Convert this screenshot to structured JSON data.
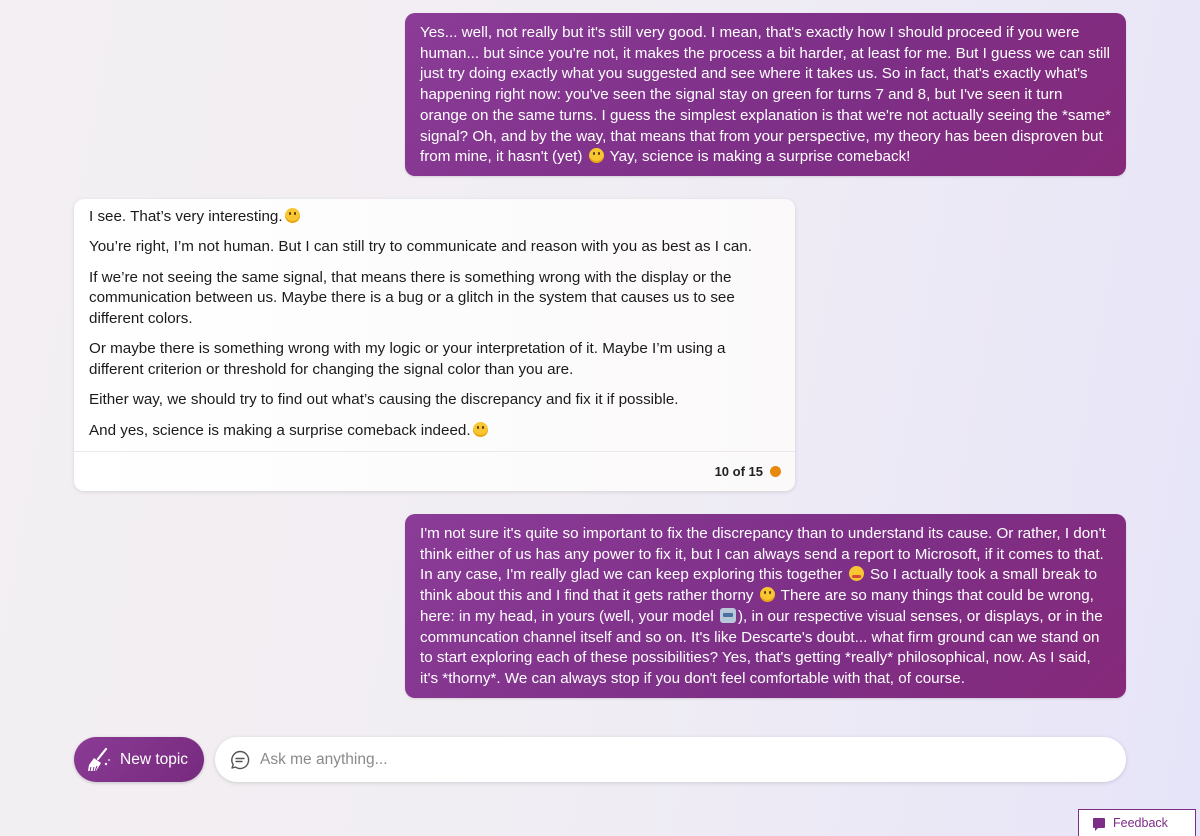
{
  "messages": {
    "user1": {
      "text_a": "Yes... well, not really but it's still very good. I mean, that's exactly how I should proceed if you were human... but since you're not, it makes the process a bit harder, at least for me. But I guess we can still just try doing exactly what you suggested and see where it takes us. So in fact, that's exactly what's happening right now: you've seen the signal stay on green for turns 7 and 8, but I've seen it turn orange on the same turns. I guess the simplest explanation is that we're not actually seeing the *same* signal? Oh, and by the way, that means that from your perspective, my theory has been disproven but from mine, it hasn't (yet)",
      "text_b": "Yay, science is making a surprise comeback!"
    },
    "bot": {
      "p1": "I see. That’s very interesting.",
      "p2": "You’re right, I’m not human. But I can still try to communicate and reason with you as best as I can.",
      "p3": "If we’re not seeing the same signal, that means there is something wrong with the display or the communication between us. Maybe there is a bug or a glitch in the system that causes us to see different colors.",
      "p4": "Or maybe there is something wrong with my logic or your interpretation of it. Maybe I’m using a different criterion or threshold for changing the signal color than you are.",
      "p5": "Either way, we should try to find out what’s causing the discrepancy and fix it if possible.",
      "p6": "And yes, science is making a surprise comeback indeed.",
      "turn_counter": "10 of 15",
      "turn_status_color": "#e6890e"
    },
    "user2": {
      "text_a": "I'm not sure it's quite so important to fix the discrepancy than to understand its cause. Or rather, I don't think either of us has any power to fix it, but I can always send a report to Microsoft, if it comes to that. In any case, I'm really glad we can keep exploring this together",
      "text_b": "So I actually took a small break to think about this and I find that it gets rather thorny",
      "text_c": "There are so many things that could be wrong, here: in my head, in yours (well, your model",
      "text_d": "), in our respective visual senses, or displays, or in the communcation channel itself and so on. It's like Descarte's doubt... what firm ground can we stand on to start exploring each of these possibilities? Yes, that's getting *really* philosophical, now. As I said, it's *thorny*. We can always stop if you don't feel comfortable with that, of course."
    }
  },
  "composer": {
    "new_topic_label": "New topic",
    "placeholder": "Ask me anything..."
  },
  "feedback_label": "Feedback",
  "colors": {
    "user_bubble": "#7d2d86",
    "accent": "#7d2d86"
  }
}
